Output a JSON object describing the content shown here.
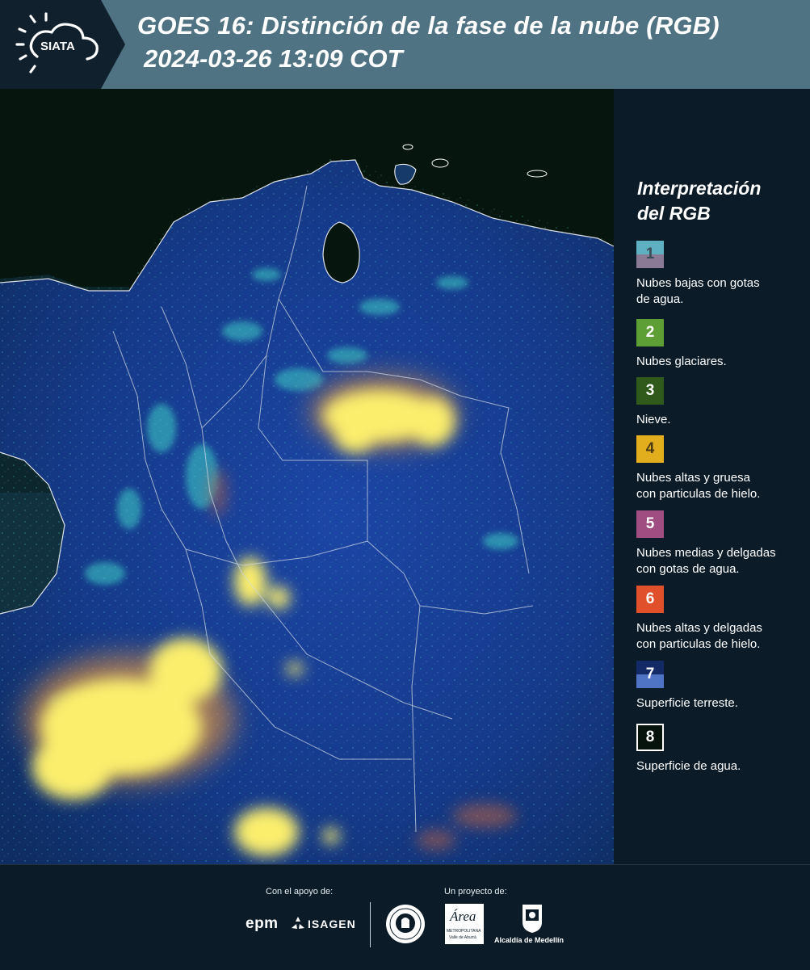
{
  "header": {
    "brand": "SIATA",
    "title_line1": "GOES 16: Distinción de la fase de la nube (RGB)",
    "title_line2": "2024-03-26 13:09 COT"
  },
  "legend": {
    "title_line1": "Interpretación",
    "title_line2": "del RGB",
    "items": [
      {
        "num": "1",
        "label_line1": "Nubes bajas con gotas",
        "label_line2": "de agua.",
        "color_top": "#5fb1c1",
        "color_bottom": "#8a7a95",
        "text_color": "#3b4a55"
      },
      {
        "num": "2",
        "label_line1": "Nubes glaciares.",
        "label_line2": "",
        "color_top": "#5d9e35",
        "color_bottom": "#5d9e35",
        "text_color": "#ffffff"
      },
      {
        "num": "3",
        "label_line1": "Nieve.",
        "label_line2": "",
        "color_top": "#2f5a1c",
        "color_bottom": "#2f5a1c",
        "text_color": "#ffffff"
      },
      {
        "num": "4",
        "label_line1": "Nubes altas y gruesa",
        "label_line2": "con particulas de hielo.",
        "color_top": "#e3ae1e",
        "color_bottom": "#e3ae1e",
        "text_color": "#4a3b14"
      },
      {
        "num": "5",
        "label_line1": "Nubes medias y delgadas",
        "label_line2": "con gotas de agua.",
        "color_top": "#a04e82",
        "color_bottom": "#a04e82",
        "text_color": "#ffffff"
      },
      {
        "num": "6",
        "label_line1": "Nubes altas y delgadas",
        "label_line2": "con particulas de hielo.",
        "color_top": "#e0502a",
        "color_bottom": "#e0502a",
        "text_color": "#ffffff"
      },
      {
        "num": "7",
        "label_line1": "Superficie terreste.",
        "label_line2": "",
        "color_top": "#132a66",
        "color_bottom": "#4f74c6",
        "text_color": "#ffffff"
      },
      {
        "num": "8",
        "label_line1": "Superficie de agua.",
        "label_line2": "",
        "color_top": "#06130d",
        "color_bottom": "#06130d",
        "text_color": "#ffffff",
        "border": "#ffffff"
      }
    ]
  },
  "footer": {
    "support_label": "Con el apoyo de:",
    "project_label": "Un proyecto de:",
    "logo_epm": "epm",
    "logo_isagen": "ISAGEN",
    "logo_area": "Área",
    "logo_area_sub1": "METROPOLITANA",
    "logo_area_sub2": "Valle de Aburrá",
    "logo_alcaldia": "Alcaldía de Medellín"
  },
  "colors": {
    "header_bg": "#4f7382",
    "panel_bg": "#0b1c28",
    "land": "#1a3a8c",
    "water": "#081612",
    "high_thick_cloud": "#f3e05a",
    "low_cloud": "#3fc9c9"
  }
}
